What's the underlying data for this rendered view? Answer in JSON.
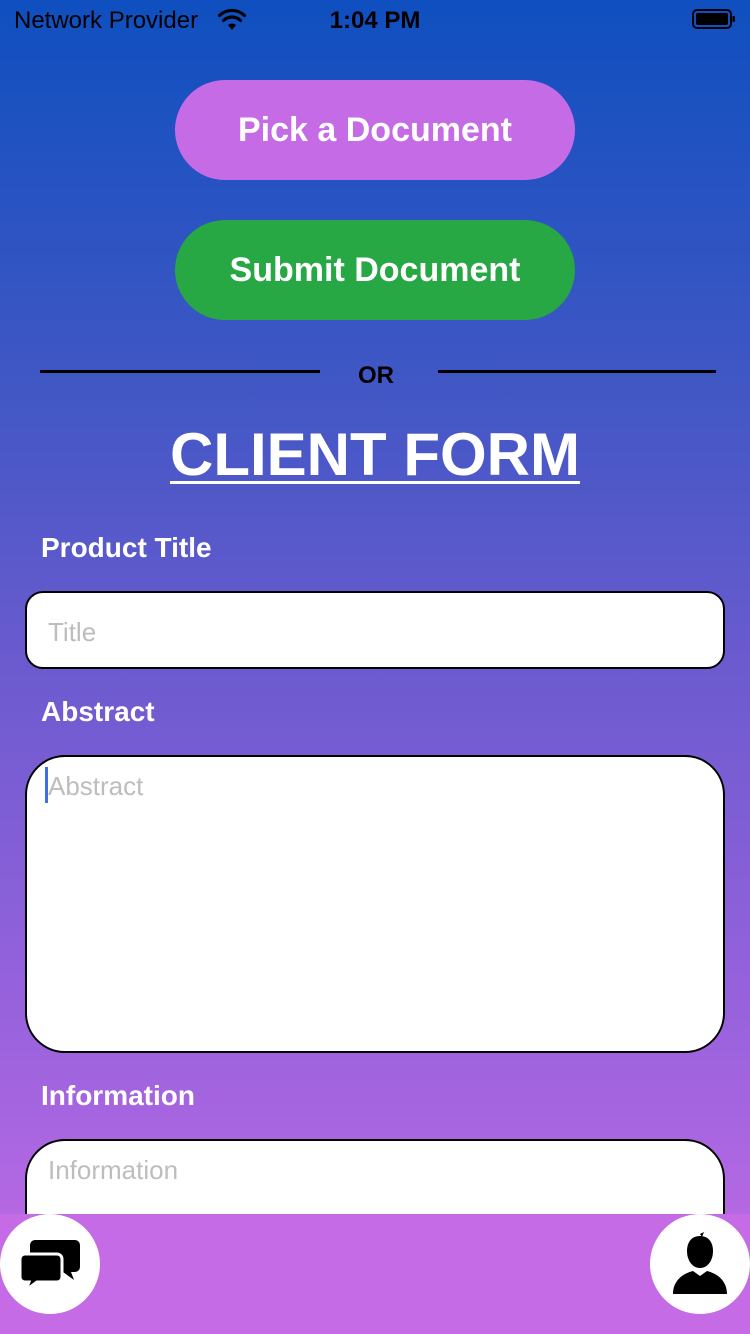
{
  "status": {
    "carrier": "Network Provider",
    "time": "1:04 PM"
  },
  "actions": {
    "pick_label": "Pick a Document",
    "submit_label": "Submit Document"
  },
  "divider": {
    "label": "OR"
  },
  "form": {
    "title": "CLIENT FORM",
    "fields": {
      "product_title": {
        "label": "Product Title",
        "placeholder": "Title",
        "value": ""
      },
      "abstract": {
        "label": "Abstract",
        "placeholder": "Abstract",
        "value": ""
      },
      "information": {
        "label": "Information",
        "placeholder": "Information",
        "value": ""
      }
    }
  },
  "nav": {
    "left_icon": "chat-bubbles-icon",
    "right_icon": "user-silhouette-icon"
  },
  "colors": {
    "gradient_top": "#0f4fbf",
    "gradient_bottom": "#c56be6",
    "pick_button": "#c56be6",
    "submit_button": "#28a745",
    "caret": "#3f6fe8"
  }
}
